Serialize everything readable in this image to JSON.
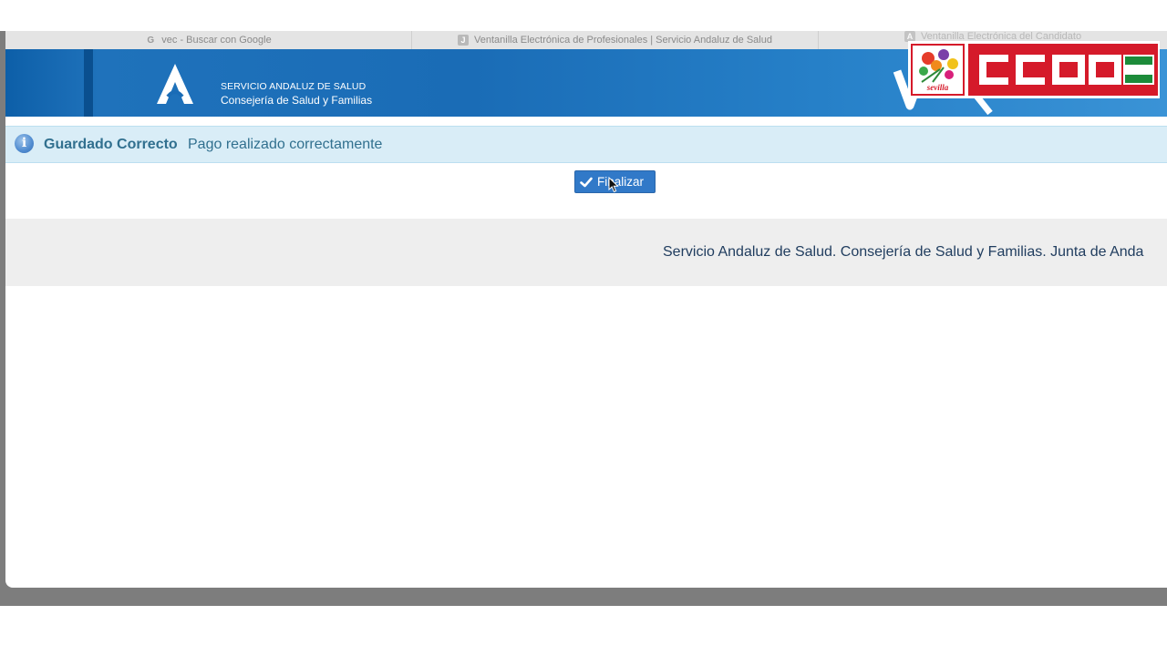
{
  "browser": {
    "tabs": [
      {
        "label": "vec - Buscar con Google",
        "icon": "google-icon"
      },
      {
        "label": "Ventanilla Electrónica de Profesionales | Servicio Andaluz de Salud",
        "icon": "j-favicon-icon"
      },
      {
        "label": "Ventanilla Electrónica del Candidato",
        "icon": "junta-favicon-icon"
      }
    ]
  },
  "header": {
    "org_line1": "SERVICIO ANDALUZ DE SALUD",
    "org_line2": "Consejería de Salud y Familias",
    "brand_color": "#1a6cb6"
  },
  "overlay": {
    "sevilla_label": "sevilla",
    "ccoo_logo": "CCOO",
    "ccoo_color": "#d51a2a"
  },
  "alert": {
    "title": "Guardado Correcto",
    "message": "Pago realizado correctamente",
    "icon": "info-icon",
    "color": "#31708f"
  },
  "actions": {
    "finish_label": "Finalizar",
    "finish_icon": "check-icon"
  },
  "footer": {
    "text": "Servicio Andaluz de Salud. Consejería de Salud y Familias. Junta de Anda"
  }
}
